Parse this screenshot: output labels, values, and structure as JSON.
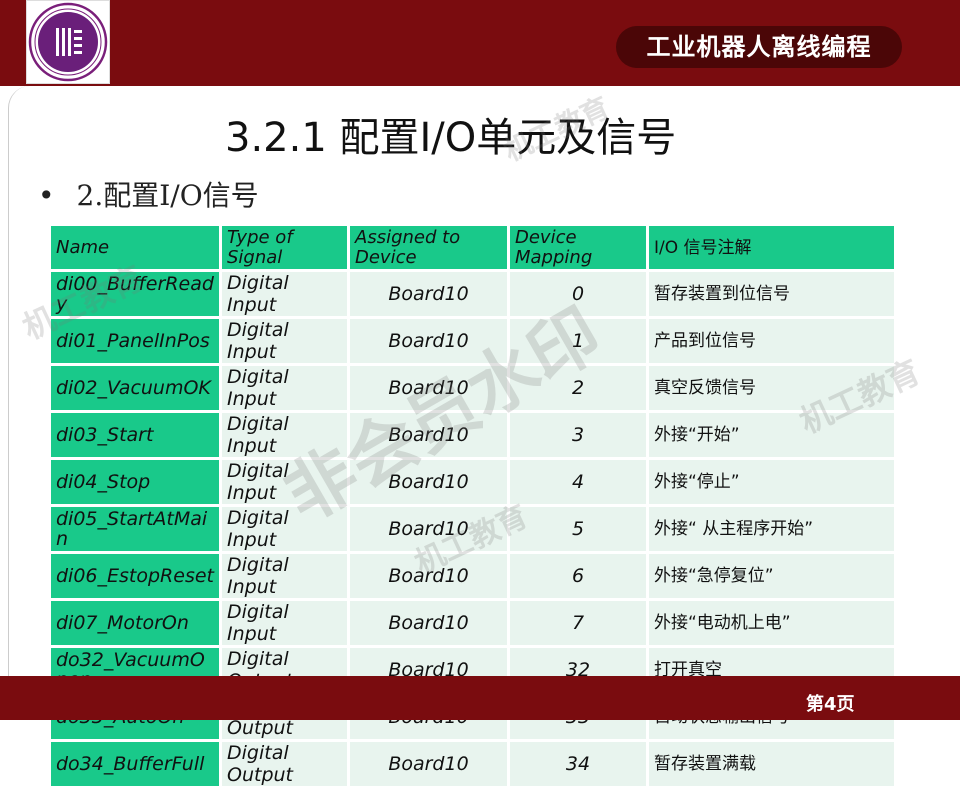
{
  "header": {
    "course_title": "工业机器人离线编程"
  },
  "slide": {
    "heading": "3.2.1   配置I/O单元及信号",
    "bullet": "2.配置I/O信号",
    "page_number": "第4页"
  },
  "table": {
    "headers": [
      "Name",
      "Type of Signal",
      "Assigned to Device",
      "Device Mapping",
      "I/O 信号注解"
    ],
    "rows": [
      {
        "name": "di00_BufferReady",
        "type": "Digital Input",
        "device": "Board10",
        "mapping": "0",
        "note": "暂存装置到位信号"
      },
      {
        "name": "di01_PanelInPos",
        "type": "Digital Input",
        "device": "Board10",
        "mapping": "1",
        "note": "产品到位信号"
      },
      {
        "name": "di02_VacuumOK",
        "type": "Digital Input",
        "device": "Board10",
        "mapping": "2",
        "note": "真空反馈信号"
      },
      {
        "name": "di03_Start",
        "type": "Digital Input",
        "device": "Board10",
        "mapping": "3",
        "note": "外接“开始”"
      },
      {
        "name": "di04_Stop",
        "type": "Digital Input",
        "device": "Board10",
        "mapping": "4",
        "note": "外接“停止”"
      },
      {
        "name": "di05_StartAtMain",
        "type": "Digital Input",
        "device": "Board10",
        "mapping": "5",
        "note": "外接“ 从主程序开始”"
      },
      {
        "name": "di06_EstopReset",
        "type": "Digital Input",
        "device": "Board10",
        "mapping": "6",
        "note": "外接“急停复位”"
      },
      {
        "name": "di07_MotorOn",
        "type": "Digital Input",
        "device": "Board10",
        "mapping": "7",
        "note": "外接“电动机上电”"
      },
      {
        "name": "do32_VacuumOpen",
        "type": "Digital Output",
        "device": "Board10",
        "mapping": "32",
        "note": "打开真空"
      },
      {
        "name": "do33_AutoOn",
        "type": "Digital Output",
        "device": "Board10",
        "mapping": "33",
        "note": "自动状态输出信号"
      },
      {
        "name": "do34_BufferFull",
        "type": "Digital Output",
        "device": "Board10",
        "mapping": "34",
        "note": "暂存装置满载"
      }
    ]
  },
  "watermarks": [
    "机工教育",
    "机工教育",
    "机工教育",
    "机工教育",
    "非会员水印"
  ],
  "colors": {
    "brand_red": "#7a0c0f",
    "pill_dark": "#4b0607",
    "table_green": "#19c98a",
    "cell_light": "#e8f4ee"
  }
}
